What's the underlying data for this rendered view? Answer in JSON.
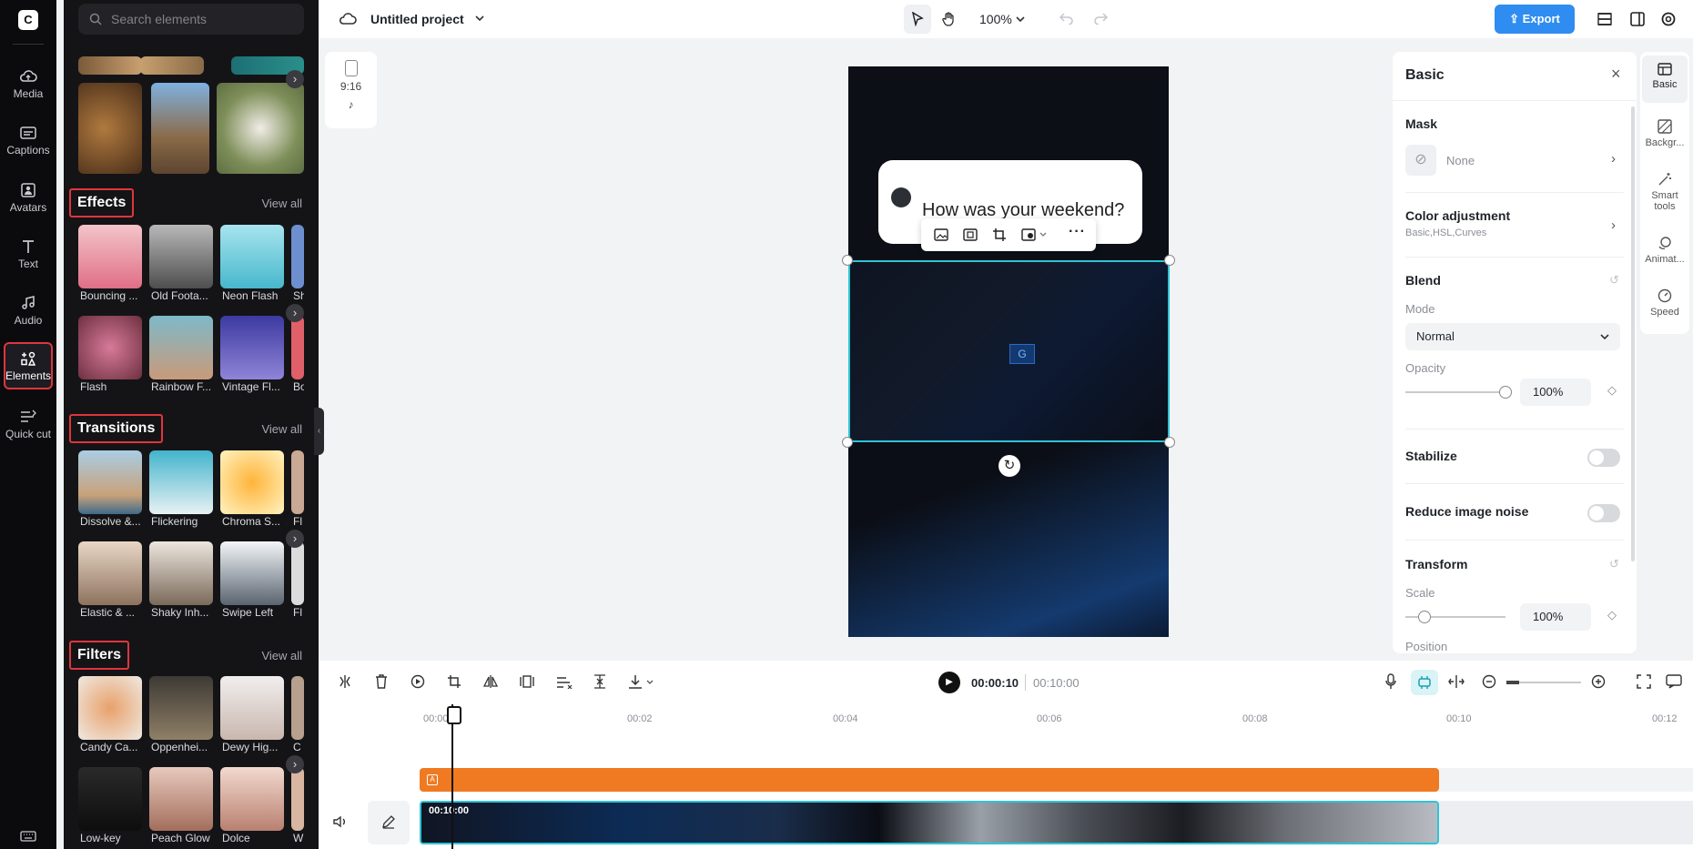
{
  "rail": {
    "items": [
      {
        "label": "Media"
      },
      {
        "label": "Captions"
      },
      {
        "label": "Avatars"
      },
      {
        "label": "Text"
      },
      {
        "label": "Audio"
      },
      {
        "label": "Elements"
      },
      {
        "label": "Quick cut"
      }
    ]
  },
  "panel": {
    "search_placeholder": "Search elements",
    "effects": {
      "title": "Effects",
      "view_all": "View all",
      "items": [
        "Bouncing ...",
        "Old Foota...",
        "Neon Flash",
        "Sh",
        "Flash",
        "Rainbow F...",
        "Vintage Fl...",
        "Bo"
      ]
    },
    "transitions": {
      "title": "Transitions",
      "view_all": "View all",
      "items": [
        "Dissolve &...",
        "Flickering",
        "Chroma S...",
        "Fl",
        "Elastic & ...",
        "Shaky Inh...",
        "Swipe Left",
        "Fl"
      ]
    },
    "filters": {
      "title": "Filters",
      "view_all": "View all",
      "items": [
        "Candy Ca...",
        "Oppenhei...",
        "Dewy Hig...",
        "C",
        "Low-key",
        "Peach Glow",
        "Dolce",
        "W"
      ]
    }
  },
  "topbar": {
    "project_title": "Untitled project",
    "zoom": "100%",
    "export_label": "Export"
  },
  "ratio": {
    "label": "9:16"
  },
  "canvas": {
    "bubble_text": "How was your weekend?"
  },
  "right_panel": {
    "title": "Basic",
    "mask_label": "Mask",
    "mask_value": "None",
    "color_adjust_label": "Color adjustment",
    "color_adjust_sub": "Basic,HSL,Curves",
    "blend_label": "Blend",
    "mode_label": "Mode",
    "mode_value": "Normal",
    "opacity_label": "Opacity",
    "opacity_value": "100%",
    "stabilize_label": "Stabilize",
    "noise_label": "Reduce image noise",
    "transform_label": "Transform",
    "scale_label": "Scale",
    "scale_value": "100%",
    "position_label": "Position"
  },
  "right_tabs": [
    "Basic",
    "Backgr...",
    "Smart tools",
    "Animat...",
    "Speed"
  ],
  "timeline": {
    "current_time": "00:00:10",
    "total_time": "00:10:00",
    "ruler": [
      "00:00",
      "00:02",
      "00:04",
      "00:06",
      "00:08",
      "00:10",
      "00:12"
    ],
    "clip_timecode": "00:10:00"
  },
  "colors": {
    "accent": "#2f8cf0",
    "selection": "#2ec4d6",
    "text_track": "#ef7a22",
    "highlight_border": "#e0353d"
  }
}
